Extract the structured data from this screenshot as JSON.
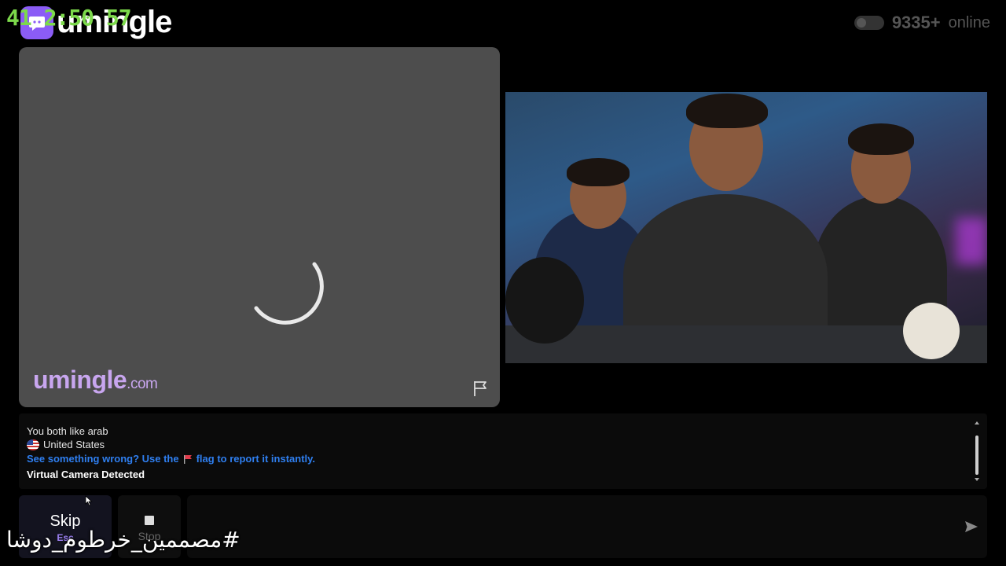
{
  "brand": {
    "name": "umingle",
    "logo_icon": "chat-bubble-icon"
  },
  "overlay": {
    "timer": "41 2:50 57",
    "hashtag": "#مصممين_خرطوم_دوشا"
  },
  "header": {
    "online_count": "9335+",
    "online_label": "online"
  },
  "stranger_video": {
    "watermark_name": "umingle",
    "watermark_domain": ".com",
    "flag_icon": "flag-icon",
    "loading": true
  },
  "chat": {
    "messages": [
      {
        "text": "You both like arab"
      },
      {
        "text": "United States",
        "icon": "us-flag-icon"
      },
      {
        "text_before": "See something wrong? Use the",
        "text_after": "flag to report it instantly.",
        "icon": "red-flag-icon",
        "color": "#2f7ff0"
      },
      {
        "text": "Virtual Camera Detected"
      }
    ]
  },
  "controls": {
    "skip_label": "Skip",
    "skip_key": "Esc",
    "stop_label": "Stop",
    "message_placeholder": "",
    "send_icon": "send-icon"
  },
  "colors": {
    "accent": "#8b5cf6",
    "watermark": "#c8a6ef",
    "link": "#2f7ff0",
    "timer": "#7cd94b"
  }
}
